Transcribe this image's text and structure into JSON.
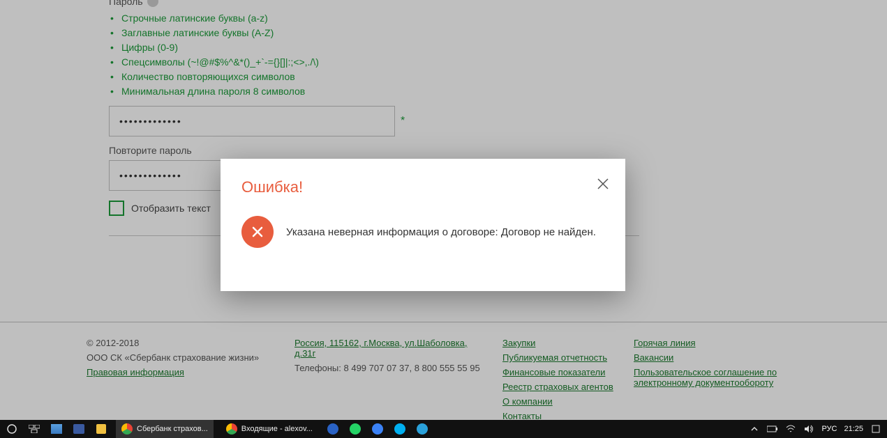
{
  "form": {
    "password_label": "Пароль",
    "requirements": [
      "Строчные латинские буквы (a-z)",
      "Заглавные латинские буквы (A-Z)",
      "Цифры (0-9)",
      "Спецсимволы (~!@#$%^&*()_+`-={}[]|:;<>,./\\)",
      "Количество повторяющихся символов",
      "Минимальная длина пароля 8 символов"
    ],
    "password_value": "•••••••••••••",
    "repeat_label": "Повторите пароль",
    "repeat_value": "•••••••••••••",
    "show_text_label": "Отобразить текст"
  },
  "modal": {
    "title": "Ошибка!",
    "message": "Указана неверная информация о договоре: Договор не найден."
  },
  "footer": {
    "copyright": "© 2012-2018",
    "company": "ООО СК «Сбербанк страхование жизни»",
    "legal": "Правовая информация",
    "address": "Россия, 115162, г.Москва, ул.Шаболовка, д.31г",
    "phones": "Телефоны: 8 499 707 07 37, 8 800 555 55 95",
    "col3": [
      "Закупки",
      "Публикуемая отчетность",
      "Финансовые показатели",
      "Реестр страховых агентов",
      "О компании",
      "Контакты"
    ],
    "col4": [
      "Горячая линия",
      "Вакансии",
      "Пользовательское соглашение по электронному документообороту"
    ]
  },
  "taskbar": {
    "tabs": [
      {
        "label": "Сбербанк страхов..."
      },
      {
        "label": "Входящие - alexov..."
      }
    ],
    "lang": "РУС",
    "time": "21:25"
  }
}
